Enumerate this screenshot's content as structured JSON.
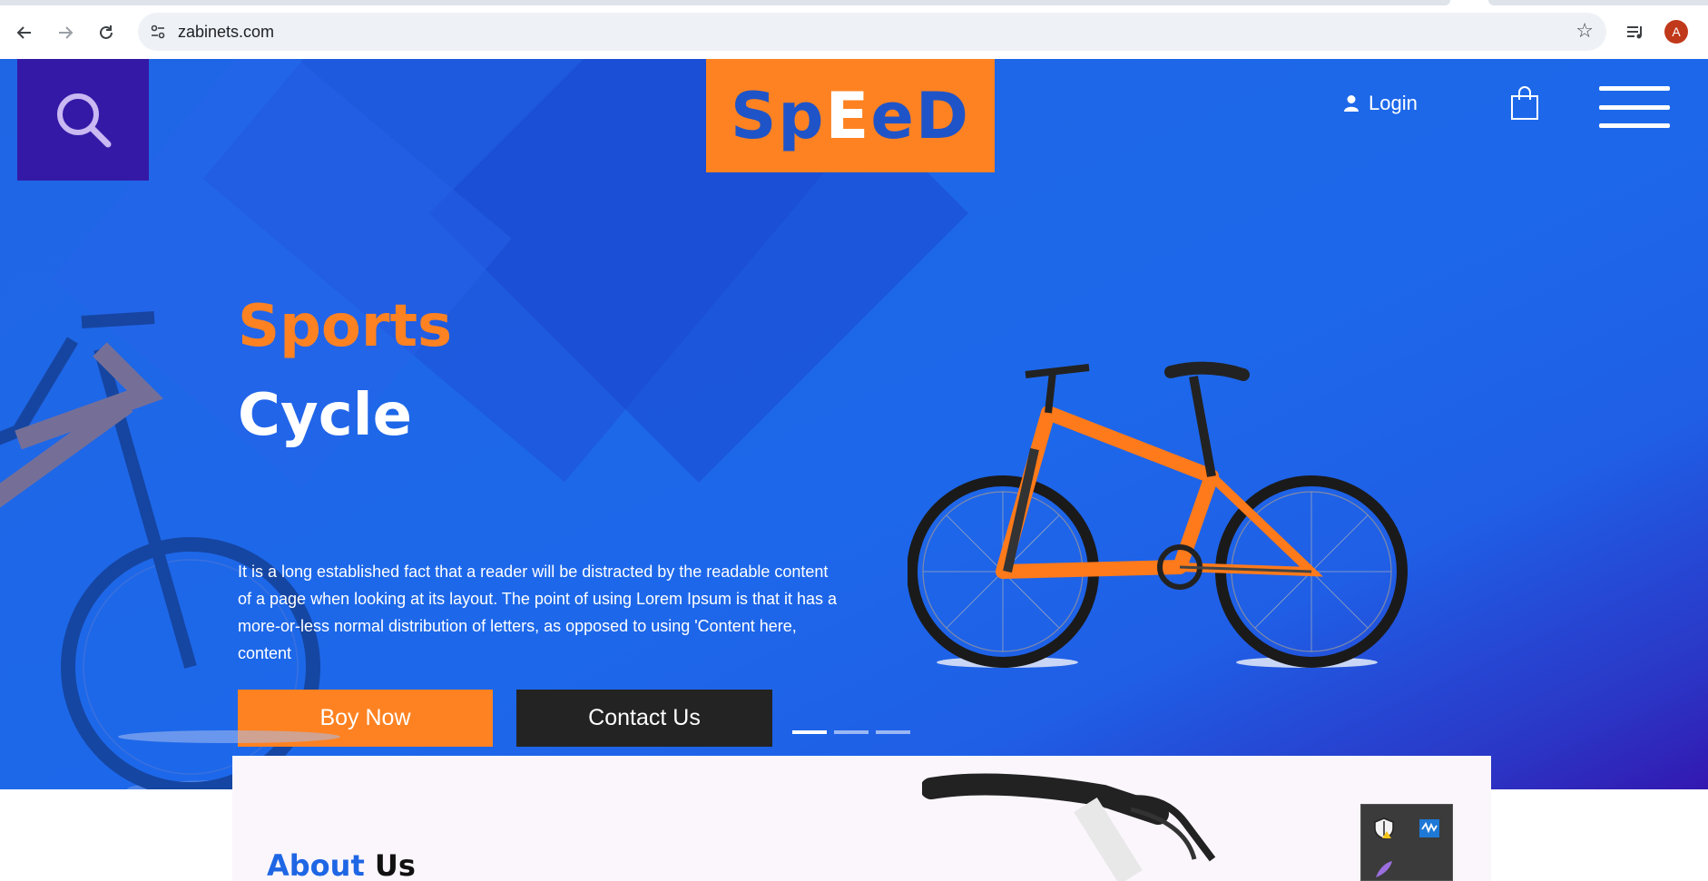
{
  "browser": {
    "url": "zabinets.com",
    "avatar_letter": "A",
    "icons": [
      "back-icon",
      "forward-icon",
      "reload-icon",
      "site-info-icon",
      "bookmark-star-icon",
      "media-control-icon"
    ]
  },
  "header": {
    "logo_text_1": "Sp",
    "logo_text_2": "E",
    "logo_text_3": "eD",
    "login_label": "Login"
  },
  "hero": {
    "title_line1": "Sports",
    "title_line2": "Cycle",
    "description": "It is a long established fact that a reader will be distracted by the readable content of a page when looking at its layout. The point of using Lorem Ipsum is that it has a more-or-less normal distribution of letters, as opposed to using 'Content here, content",
    "buy_label": "Boy Now",
    "contact_label": "Contact Us",
    "slides_total": 3,
    "slide_active": 1
  },
  "about": {
    "title_part1": "About",
    "title_part2": "Us"
  },
  "colors": {
    "accent_orange": "#fe8221",
    "hero_blue": "#1e66e4",
    "dark_purple": "#3419a6",
    "button_dark": "#232323"
  }
}
